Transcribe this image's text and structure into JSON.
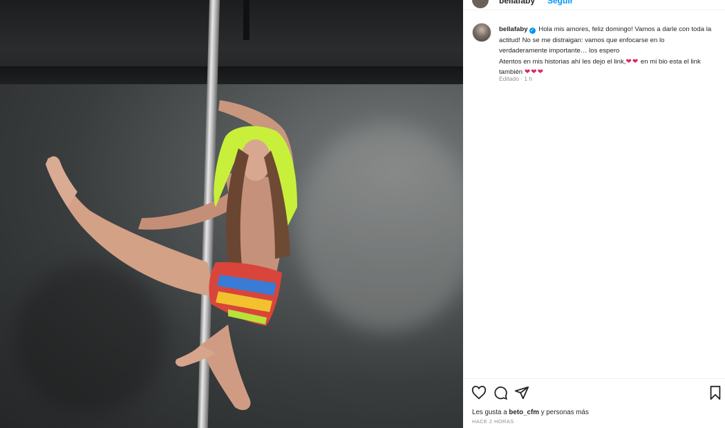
{
  "post": {
    "image_alt": "Woman in neon yellow hood and colorful shorts performing on a dance pole against a dark wall"
  },
  "header": {
    "username": "bellafaby",
    "follow_label": "Seguir"
  },
  "caption": {
    "username": "bellafaby",
    "line1": "Hola mis amores, feliz domingo! Vamos a darle con toda la actitud! No se me distraigan: vamos que enfocarse en lo verdaderamente importante… los espero",
    "line2_before": "Atentos en mis historias ahí les dejo el link,",
    "line2_hearts": "❤❤",
    "line2_after": "en mi bio esta el link también",
    "line2_end_hearts": "❤❤❤",
    "meta": "Editado · 1 h"
  },
  "actions": {
    "like_icon": "heart-icon",
    "comment_icon": "comment-icon",
    "share_icon": "share-icon",
    "save_icon": "bookmark-icon"
  },
  "likes": {
    "prefix": "Les gusta a",
    "user": "beto_cfm",
    "suffix": "y personas más"
  },
  "timestamp": "HACE 2 HORAS",
  "colors": {
    "link_blue": "#0095f6",
    "heart_red": "#e0245e",
    "muted": "#8e8e8e"
  }
}
